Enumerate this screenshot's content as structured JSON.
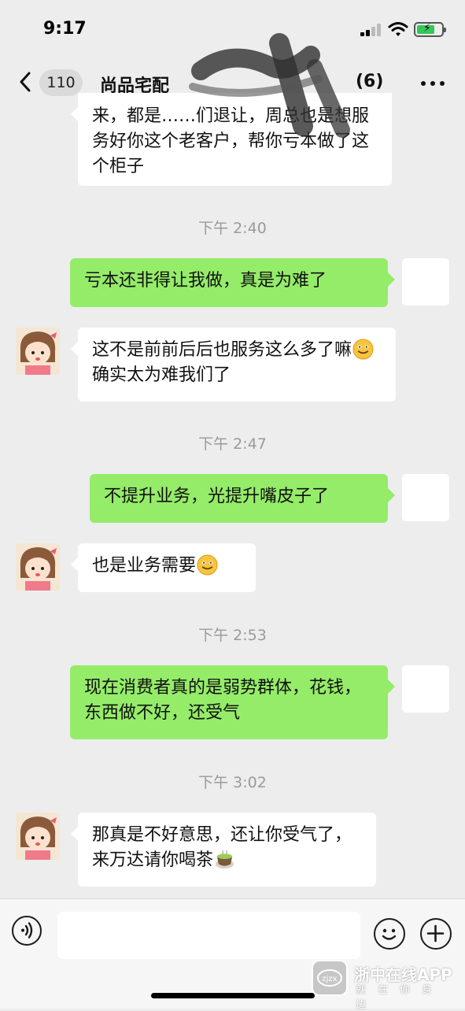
{
  "status_bar": {
    "time": "9:17",
    "battery_charging": true
  },
  "header": {
    "back_count": "110",
    "title": "尚品宅配",
    "member_count": "(6)"
  },
  "messages": [
    {
      "type": "in",
      "text": "来，都是……们退让，周总也是想服务好你这个老客户，帮你亏本做了这个柜子"
    },
    {
      "type": "time",
      "text": "下午 2:40"
    },
    {
      "type": "out",
      "text": "亏本还非得让我做，真是为难了"
    },
    {
      "type": "in",
      "text_before": "这不是前前后后也服务这么多了嘛",
      "emoji": "smile",
      "text_after": "确实太为难我们了"
    },
    {
      "type": "time",
      "text": "下午 2:47"
    },
    {
      "type": "out",
      "text": "不提升业务，光提升嘴皮子了"
    },
    {
      "type": "in",
      "text_before": "也是业务需要",
      "emoji": "smile",
      "text_after": ""
    },
    {
      "type": "time",
      "text": "下午 2:53"
    },
    {
      "type": "out",
      "text": "现在消费者真的是弱势群体，花钱，东西做不好，还受气"
    },
    {
      "type": "time",
      "text": "下午 3:02"
    },
    {
      "type": "in",
      "text_before": "那真是不好意思，还让你受气了，来万达请你喝茶",
      "emoji": "tea",
      "text_after": ""
    }
  ],
  "input": {
    "value": "",
    "placeholder": ""
  },
  "watermark": {
    "name": "浙中在线APP",
    "slogan": "就在你身边",
    "logo_text": "zjzx"
  },
  "colors": {
    "background": "#ededed",
    "outgoing_bubble": "#95ec69",
    "incoming_bubble": "#ffffff",
    "timestamp": "#9a9a9a"
  },
  "icons": [
    "chevron-left-icon",
    "more-icon",
    "voice-icon",
    "emoji-icon",
    "plus-icon",
    "smile-emoji-icon",
    "tea-emoji-icon",
    "signal-icon",
    "wifi-icon",
    "battery-icon"
  ]
}
